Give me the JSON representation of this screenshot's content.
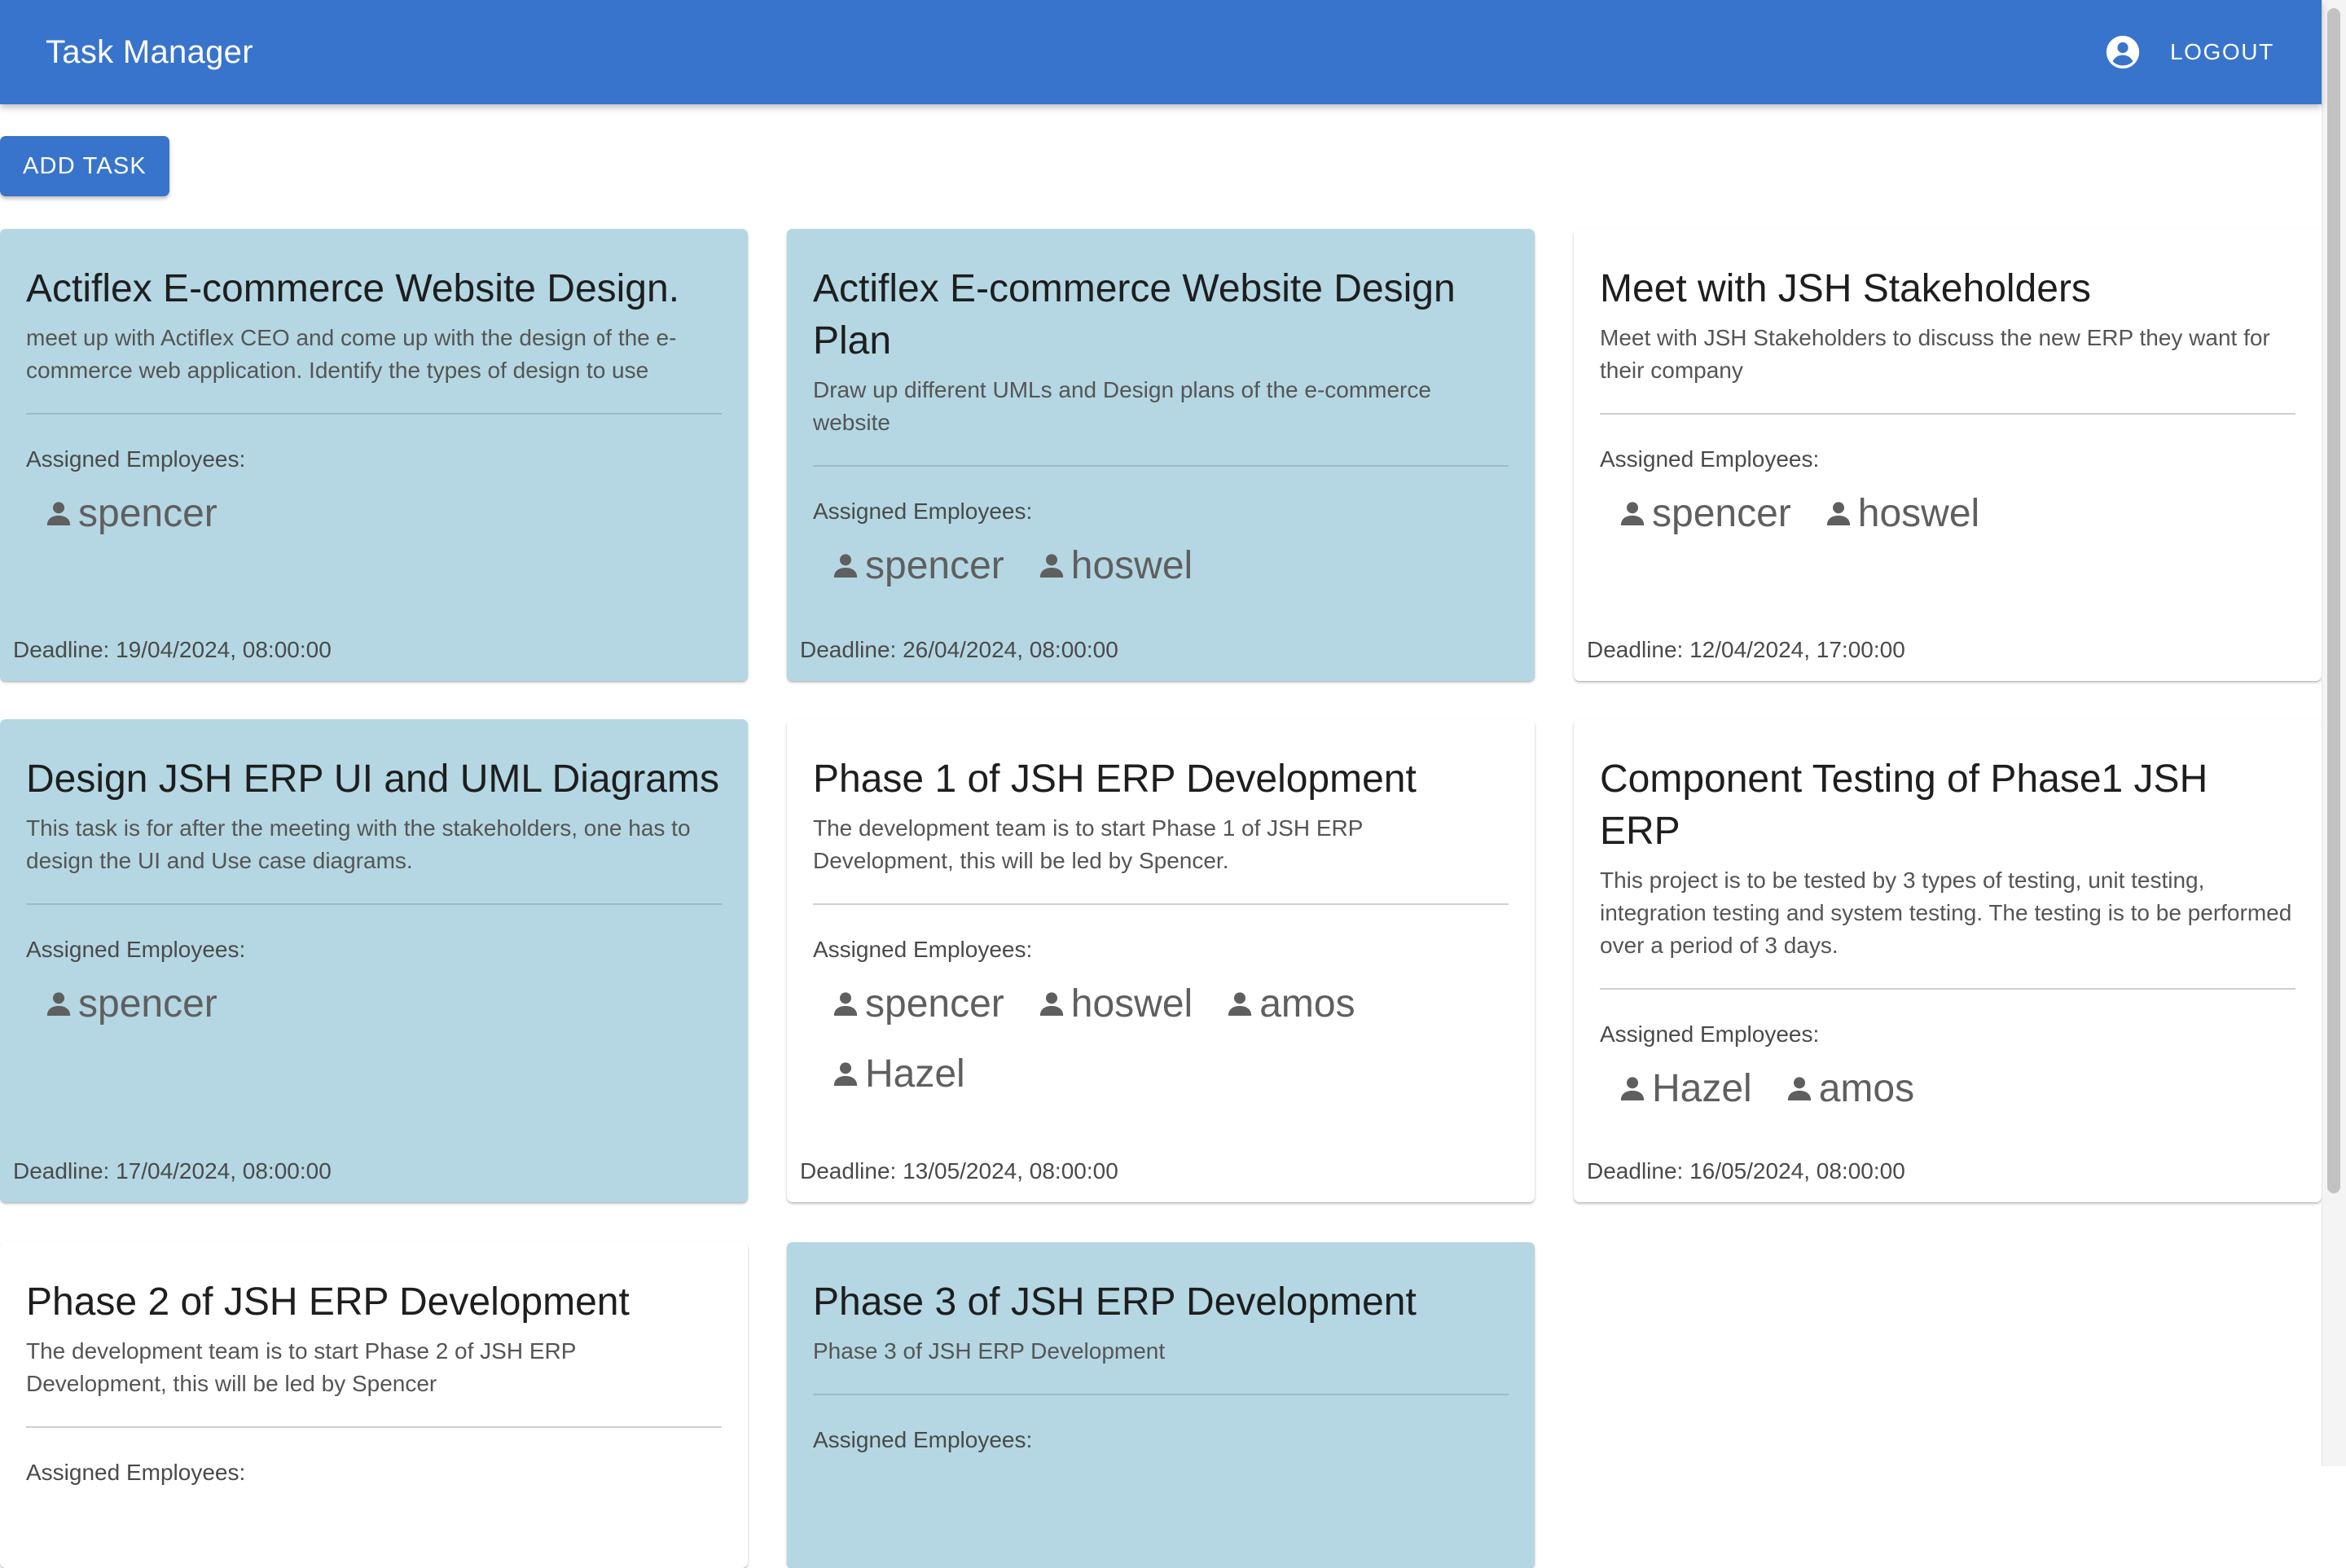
{
  "app": {
    "title": "Task Manager",
    "logout_label": "LOGOUT",
    "add_task_label": "ADD TASK",
    "brand_color": "#3874cb",
    "highlight_color": "#b4d7e3"
  },
  "labels": {
    "assigned": "Assigned Employees:"
  },
  "icons": {
    "account": "account-circle-icon",
    "person": "person-icon"
  },
  "tasks": [
    {
      "title": "Actiflex E-commerce Website Design.",
      "description": "meet up with Actiflex CEO and come up with the design of the e-commerce web application. Identify the types of design to use",
      "employees": [
        "spencer"
      ],
      "deadline": "Deadline: 19/04/2024, 08:00:00",
      "highlighted": true
    },
    {
      "title": "Actiflex E-commerce Website Design Plan",
      "description": "Draw up different UMLs and Design plans of the e-commerce website",
      "employees": [
        "spencer",
        "hoswel"
      ],
      "deadline": "Deadline: 26/04/2024, 08:00:00",
      "highlighted": true
    },
    {
      "title": "Meet with JSH Stakeholders",
      "description": "Meet with JSH Stakeholders to discuss the new ERP they want for their company",
      "employees": [
        "spencer",
        "hoswel"
      ],
      "deadline": "Deadline: 12/04/2024, 17:00:00",
      "highlighted": false
    },
    {
      "title": "Design JSH ERP UI and UML Diagrams",
      "description": "This task is for after the meeting with the stakeholders, one has to design the UI and Use case diagrams.",
      "employees": [
        "spencer"
      ],
      "deadline": "Deadline: 17/04/2024, 08:00:00",
      "highlighted": true
    },
    {
      "title": "Phase 1 of JSH ERP Development",
      "description": "The development team is to start Phase 1 of JSH ERP Development, this will be led by Spencer.",
      "employees": [
        "spencer",
        "hoswel",
        "amos",
        "Hazel"
      ],
      "deadline": "Deadline: 13/05/2024, 08:00:00",
      "highlighted": false
    },
    {
      "title": "Component Testing of Phase1 JSH ERP",
      "description": "This project is to be tested by 3 types of testing, unit testing, integration testing and system testing. The testing is to be performed over a period of 3 days.",
      "employees": [
        "Hazel",
        "amos"
      ],
      "deadline": "Deadline: 16/05/2024, 08:00:00",
      "highlighted": false
    },
    {
      "title": "Phase 2 of JSH ERP Development",
      "description": "The development team is to start Phase 2 of JSH ERP Development, this will be led by Spencer",
      "employees": [],
      "deadline": "",
      "highlighted": false
    },
    {
      "title": "Phase 3 of JSH ERP Development",
      "description": "Phase 3 of JSH ERP Development",
      "employees": [],
      "deadline": "",
      "highlighted": true
    }
  ]
}
